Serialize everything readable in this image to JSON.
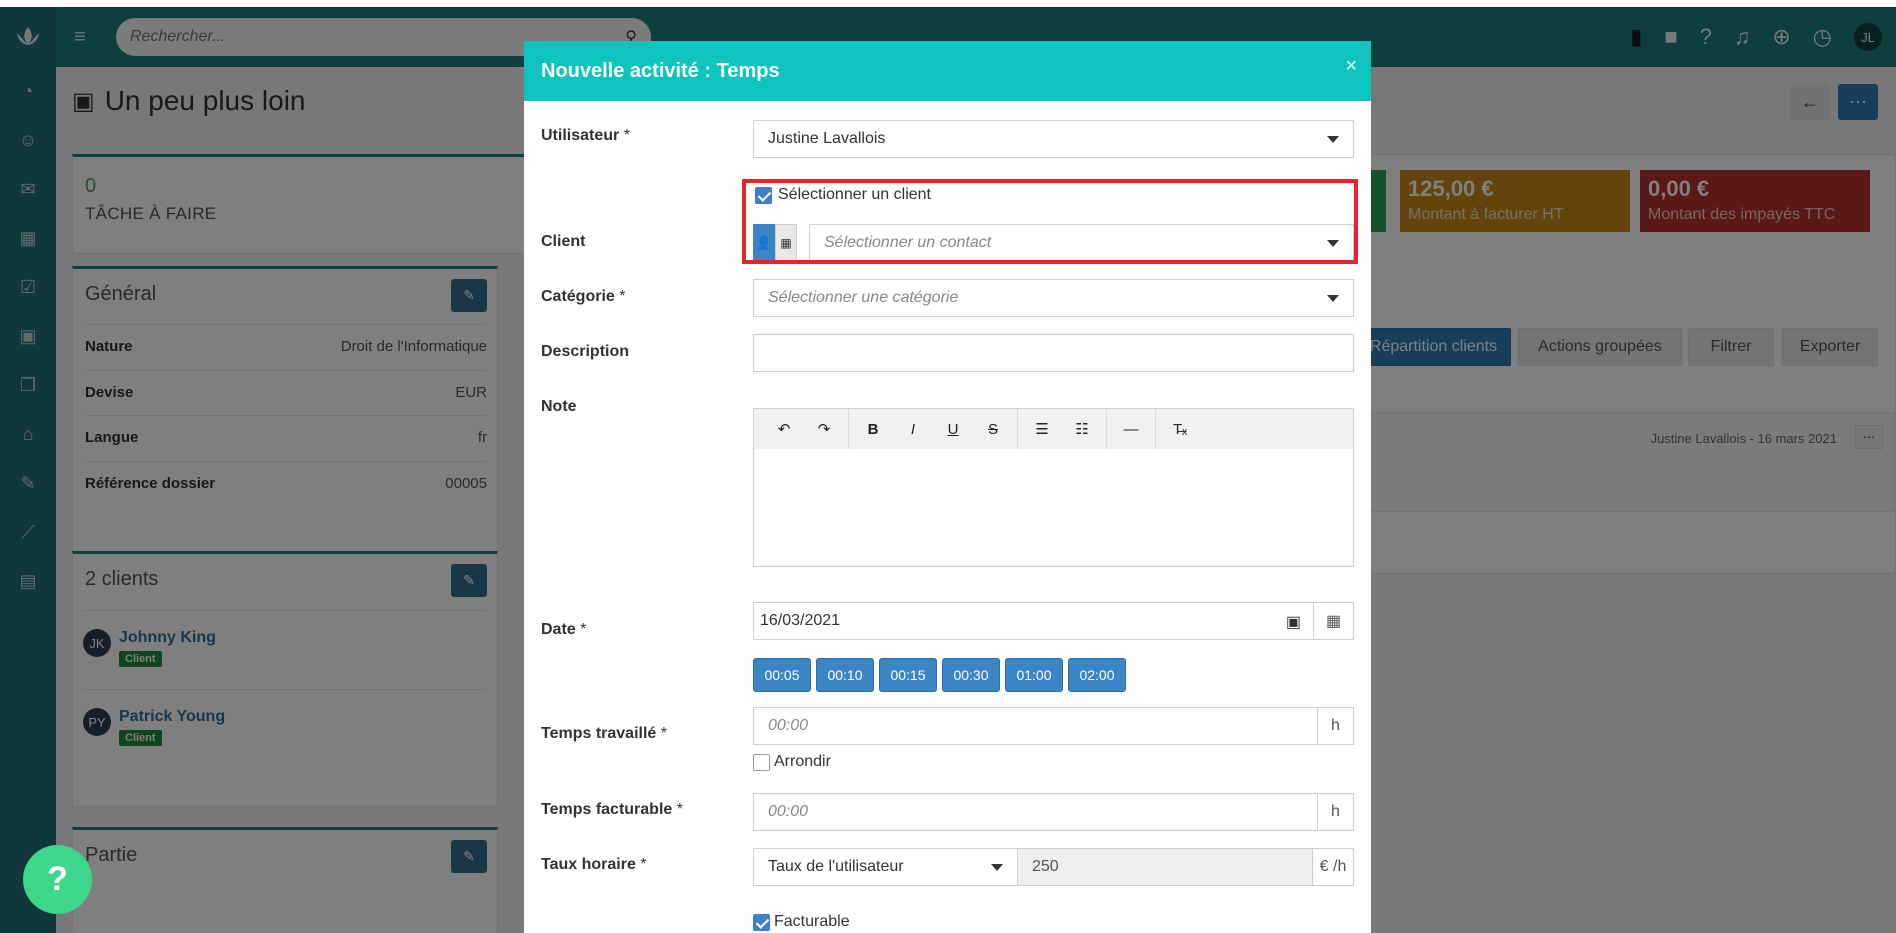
{
  "topbar": {
    "search_placeholder": "Rechercher...",
    "avatar_initials": "JL"
  },
  "page": {
    "title": "Un peu plus loin",
    "tasks": {
      "count": "0",
      "label": "TÂCHE À FAIRE"
    },
    "general": {
      "title": "Général",
      "rows": [
        {
          "key": "Nature",
          "value": "Droit de l'Informatique"
        },
        {
          "key": "Devise",
          "value": "EUR"
        },
        {
          "key": "Langue",
          "value": "fr"
        },
        {
          "key": "Référence dossier",
          "value": "00005"
        }
      ]
    },
    "clients": {
      "title": "2 clients",
      "items": [
        {
          "initials": "JK",
          "name": "Johnny King",
          "badge": "Client"
        },
        {
          "initials": "PY",
          "name": "Patrick Young",
          "badge": "Client"
        }
      ]
    },
    "partie": {
      "title": "Partie"
    },
    "stats": [
      {
        "amount": "125,00 €",
        "label": "Montant à facturer HT",
        "color": "#c9881a"
      },
      {
        "amount": "0,00 €",
        "label": "Montant des impayés TTC",
        "color": "#b8302a"
      }
    ],
    "actions": {
      "repartition": "Répartition clients",
      "groupees": "Actions groupées",
      "filtrer": "Filtrer",
      "exporter": "Exporter"
    },
    "activity_meta": "Justine Lavallois - 16 mars 2021"
  },
  "modal": {
    "title": "Nouvelle activité : Temps",
    "utilisateur": {
      "label": "Utilisateur",
      "required": "*",
      "value": "Justine Lavallois"
    },
    "client": {
      "label": "Client",
      "select_client_label": "Sélectionner un client",
      "select_client_checked": true,
      "contact_placeholder": "Sélectionner un contact"
    },
    "categorie": {
      "label": "Catégorie",
      "required": "*",
      "placeholder": "Sélectionner une catégorie"
    },
    "description": {
      "label": "Description",
      "value": ""
    },
    "note": {
      "label": "Note"
    },
    "date": {
      "label": "Date",
      "required": "*",
      "value": "16/03/2021"
    },
    "quick_times": [
      "00:05",
      "00:10",
      "00:15",
      "00:30",
      "01:00",
      "02:00"
    ],
    "temps_travaille": {
      "label": "Temps travaillé",
      "required": "*",
      "placeholder": "00:00",
      "unit": "h"
    },
    "arrondir": {
      "label": "Arrondir",
      "checked": false
    },
    "temps_facturable": {
      "label": "Temps facturable",
      "required": "*",
      "placeholder": "00:00",
      "unit": "h"
    },
    "taux_horaire": {
      "label": "Taux horaire",
      "required": "*",
      "select": "Taux de l'utilisateur",
      "value": "250",
      "unit": "€ /h"
    },
    "facturable": {
      "label": "Facturable",
      "checked": true
    }
  },
  "colors": {
    "header": "#0fc4bf",
    "topbar": "#1f7c7e",
    "highlight": "#e3252c",
    "quick_button": "#3a86c4"
  }
}
